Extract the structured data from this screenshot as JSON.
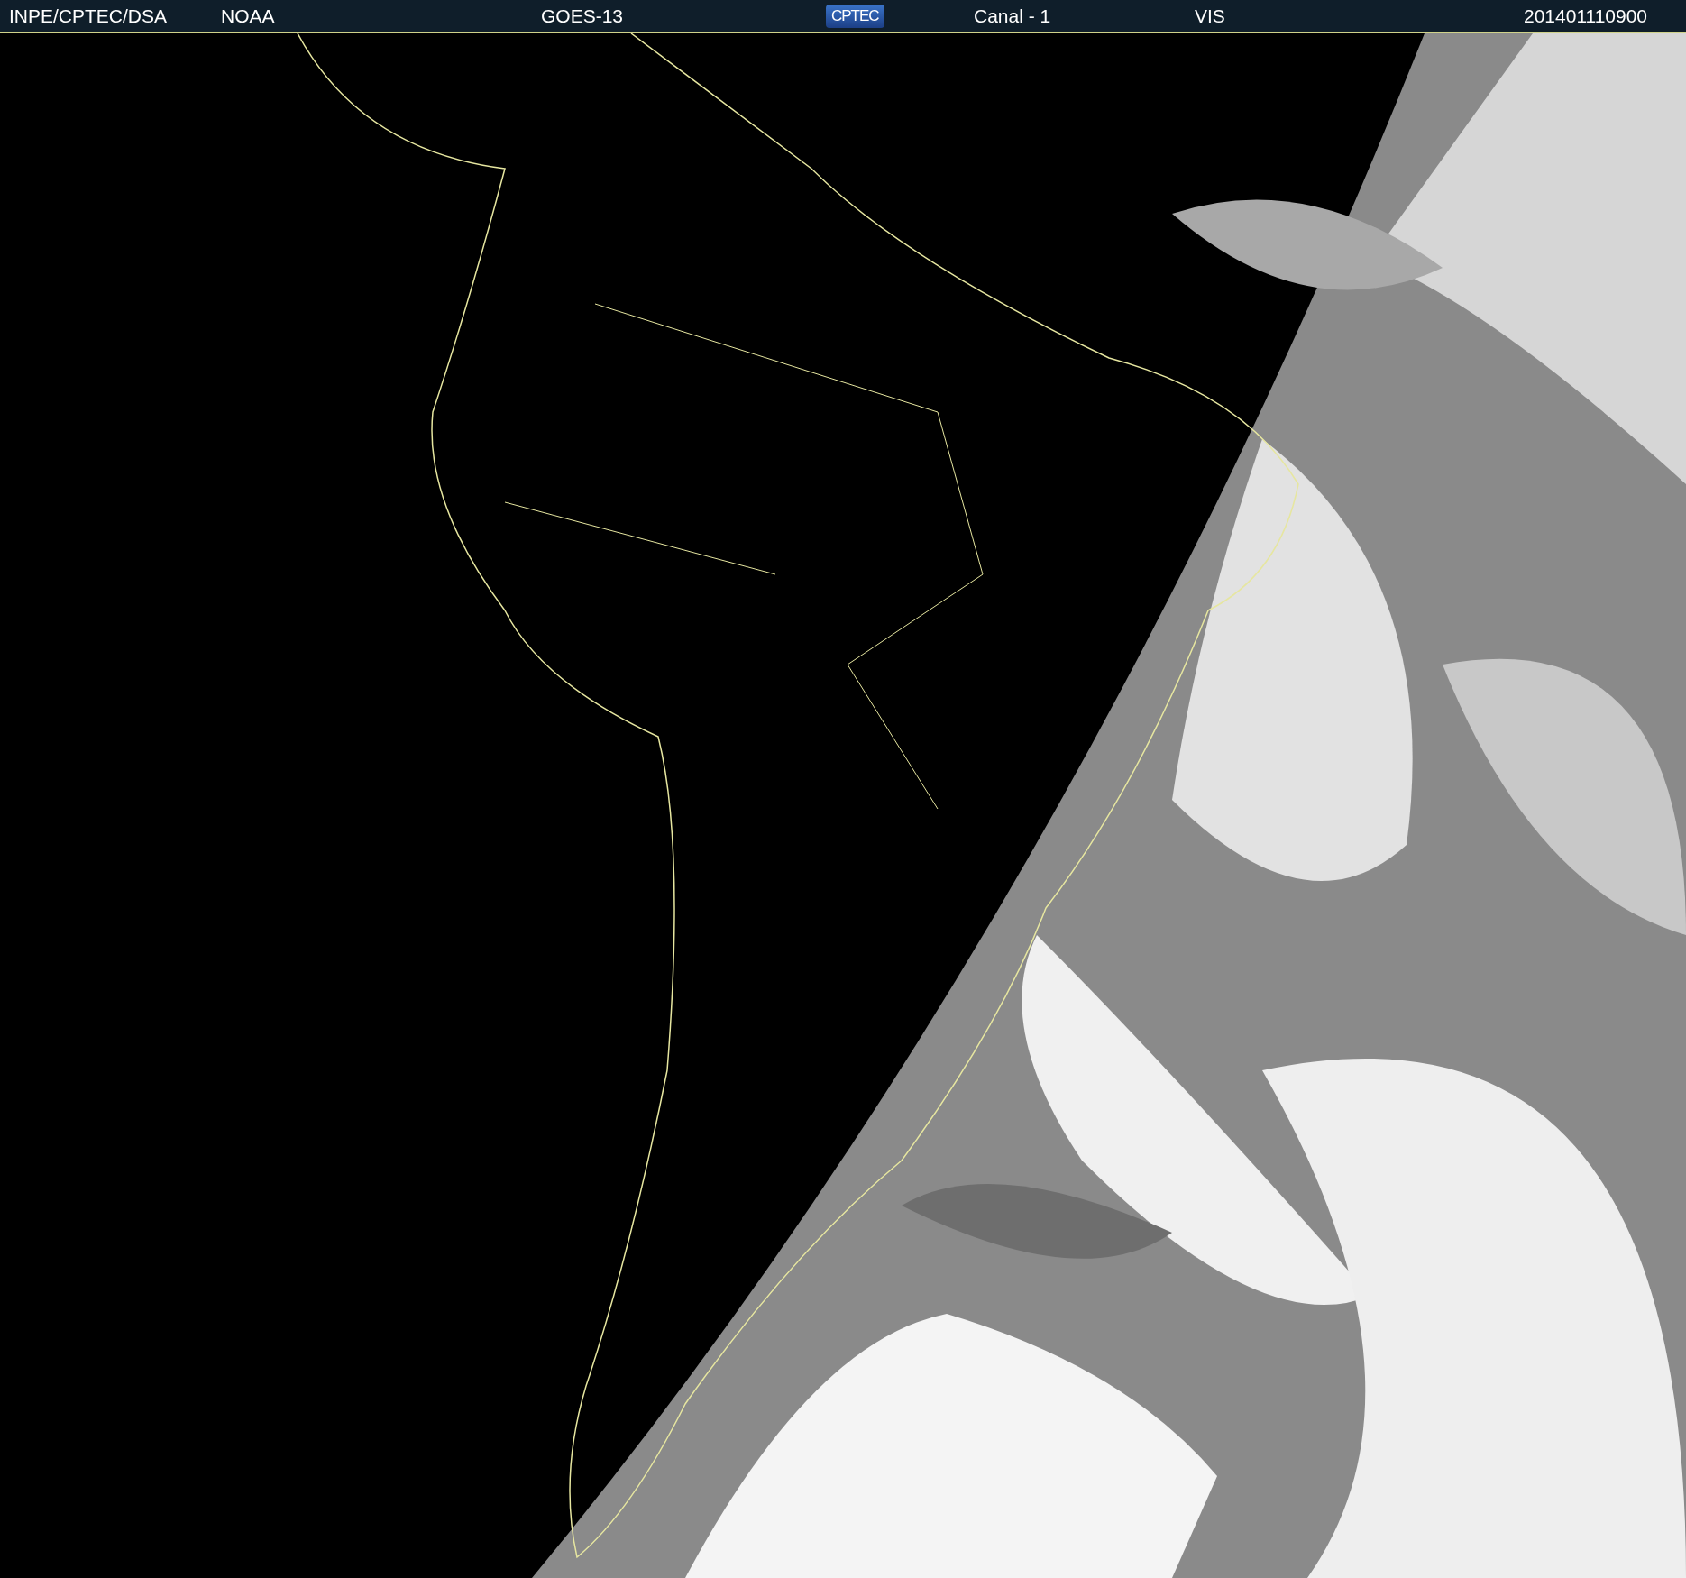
{
  "header": {
    "items": [
      {
        "kind": "text",
        "text": "INPE/CPTEC/DSA"
      },
      {
        "kind": "text",
        "text": "NOAA"
      },
      {
        "kind": "text",
        "text": "GOES-13"
      },
      {
        "kind": "logo",
        "text": "CPTEC"
      },
      {
        "kind": "text",
        "text": "Canal - 1"
      },
      {
        "kind": "text",
        "text": "VIS"
      },
      {
        "kind": "text",
        "text": "201401110900"
      }
    ]
  }
}
